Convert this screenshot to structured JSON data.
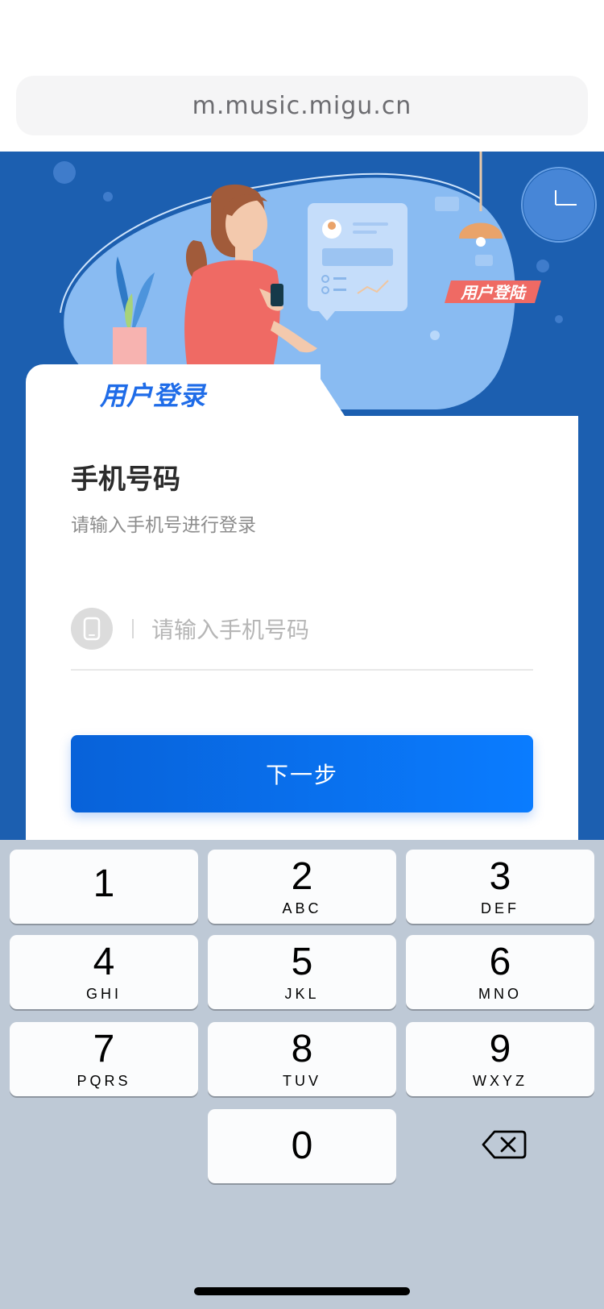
{
  "browser": {
    "url": "m.music.migu.cn"
  },
  "hero": {
    "badge_text": "用户登陆"
  },
  "card": {
    "tab_title": "用户登录",
    "title": "手机号码",
    "subtitle": "请输入手机号进行登录",
    "phone_placeholder": "请输入手机号码",
    "next_label": "下一步"
  },
  "keyboard": {
    "keys": [
      {
        "num": "1",
        "letters": ""
      },
      {
        "num": "2",
        "letters": "ABC"
      },
      {
        "num": "3",
        "letters": "DEF"
      },
      {
        "num": "4",
        "letters": "GHI"
      },
      {
        "num": "5",
        "letters": "JKL"
      },
      {
        "num": "6",
        "letters": "MNO"
      },
      {
        "num": "7",
        "letters": "PQRS"
      },
      {
        "num": "8",
        "letters": "TUV"
      },
      {
        "num": "9",
        "letters": "WXYZ"
      },
      {
        "num": "0",
        "letters": ""
      }
    ]
  },
  "colors": {
    "hero_bg": "#1c5fb0",
    "primary_blue": "#0a7cff",
    "keyboard_bg": "#bec9d6"
  }
}
